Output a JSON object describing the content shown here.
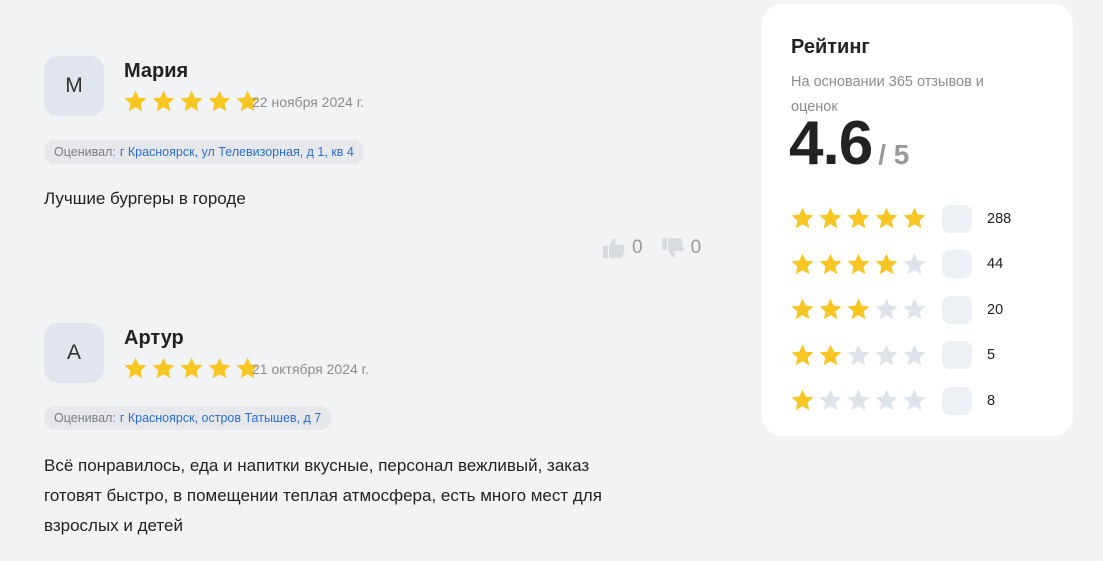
{
  "reviews": [
    {
      "initial": "М",
      "name": "Мария",
      "rating": 5,
      "date": "22 ноября 2024 г.",
      "rated_label": "Оценивал:",
      "address": "г Красноярск, ул Телевизорная, д 1, кв 4",
      "text_lines": [
        "Лучшие бургеры в городе"
      ],
      "likes": "0",
      "dislikes": "0"
    },
    {
      "initial": "А",
      "name": "Артур",
      "rating": 5,
      "date": "21 октября 2024 г.",
      "rated_label": "Оценивал:",
      "address": "г Красноярск, остров Татышев, д 7",
      "text_lines": [
        "Всё понравилось, еда и напитки вкусные, персонал вежливый, заказ",
        "готовят быстро, в помещении теплая атмосфера, есть много мест для",
        "взрослых и детей"
      ]
    }
  ],
  "rating_panel": {
    "title": "Рейтинг",
    "subtitle": "На основании 365 отзывов и оценок",
    "score": "4.6",
    "out_of": "/ 5",
    "rows": [
      {
        "stars": 5,
        "count": "288"
      },
      {
        "stars": 4,
        "count": "44"
      },
      {
        "stars": 3,
        "count": "20"
      },
      {
        "stars": 2,
        "count": "5"
      },
      {
        "stars": 1,
        "count": "8"
      }
    ]
  },
  "colors": {
    "star_filled": "#f7c623",
    "star_empty": "#dfe3ea",
    "link_blue": "#2b6fd6",
    "page_bg": "#f2f3f5",
    "panel_bg": "#ffffff"
  }
}
